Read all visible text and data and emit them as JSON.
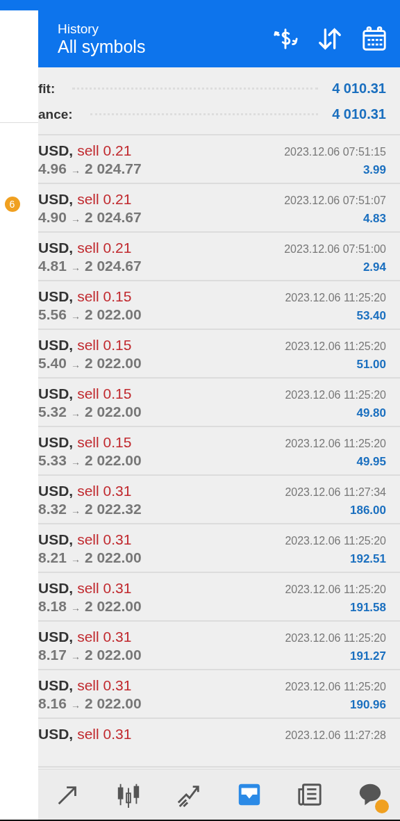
{
  "header": {
    "title": "History",
    "subtitle": "All symbols"
  },
  "drawer": {
    "badge": "6"
  },
  "summary": [
    {
      "label": "fit:",
      "value": "4 010.31"
    },
    {
      "label": "ance:",
      "value": "4 010.31"
    }
  ],
  "deals": [
    {
      "symbol": "USD,",
      "side": "sell",
      "volume": "0.21",
      "open": "4.96",
      "arrow": "→",
      "close": "2 024.77",
      "time": "2023.12.06 07:51:15",
      "profit": "3.99"
    },
    {
      "symbol": "USD,",
      "side": "sell",
      "volume": "0.21",
      "open": "4.90",
      "arrow": "→",
      "close": "2 024.67",
      "time": "2023.12.06 07:51:07",
      "profit": "4.83"
    },
    {
      "symbol": "USD,",
      "side": "sell",
      "volume": "0.21",
      "open": "4.81",
      "arrow": "→",
      "close": "2 024.67",
      "time": "2023.12.06 07:51:00",
      "profit": "2.94"
    },
    {
      "symbol": "USD,",
      "side": "sell",
      "volume": "0.15",
      "open": "5.56",
      "arrow": "→",
      "close": "2 022.00",
      "time": "2023.12.06 11:25:20",
      "profit": "53.40"
    },
    {
      "symbol": "USD,",
      "side": "sell",
      "volume": "0.15",
      "open": "5.40",
      "arrow": "→",
      "close": "2 022.00",
      "time": "2023.12.06 11:25:20",
      "profit": "51.00"
    },
    {
      "symbol": "USD,",
      "side": "sell",
      "volume": "0.15",
      "open": "5.32",
      "arrow": "→",
      "close": "2 022.00",
      "time": "2023.12.06 11:25:20",
      "profit": "49.80"
    },
    {
      "symbol": "USD,",
      "side": "sell",
      "volume": "0.15",
      "open": "5.33",
      "arrow": "→",
      "close": "2 022.00",
      "time": "2023.12.06 11:25:20",
      "profit": "49.95"
    },
    {
      "symbol": "USD,",
      "side": "sell",
      "volume": "0.31",
      "open": "8.32",
      "arrow": "→",
      "close": "2 022.32",
      "time": "2023.12.06 11:27:34",
      "profit": "186.00"
    },
    {
      "symbol": "USD,",
      "side": "sell",
      "volume": "0.31",
      "open": "8.21",
      "arrow": "→",
      "close": "2 022.00",
      "time": "2023.12.06 11:25:20",
      "profit": "192.51"
    },
    {
      "symbol": "USD,",
      "side": "sell",
      "volume": "0.31",
      "open": "8.18",
      "arrow": "→",
      "close": "2 022.00",
      "time": "2023.12.06 11:25:20",
      "profit": "191.58"
    },
    {
      "symbol": "USD,",
      "side": "sell",
      "volume": "0.31",
      "open": "8.17",
      "arrow": "→",
      "close": "2 022.00",
      "time": "2023.12.06 11:25:20",
      "profit": "191.27"
    },
    {
      "symbol": "USD,",
      "side": "sell",
      "volume": "0.31",
      "open": "8.16",
      "arrow": "→",
      "close": "2 022.00",
      "time": "2023.12.06 11:25:20",
      "profit": "190.96"
    },
    {
      "symbol": "USD,",
      "side": "sell",
      "volume": "0.31",
      "time": "2023.12.06 11:27:28"
    }
  ],
  "nav": [
    {
      "kind": "trade",
      "selected": false
    },
    {
      "kind": "chart",
      "selected": false
    },
    {
      "kind": "trend",
      "selected": false
    },
    {
      "kind": "history",
      "selected": true
    },
    {
      "kind": "news",
      "selected": false
    },
    {
      "kind": "chat",
      "selected": false,
      "badge": true
    }
  ]
}
